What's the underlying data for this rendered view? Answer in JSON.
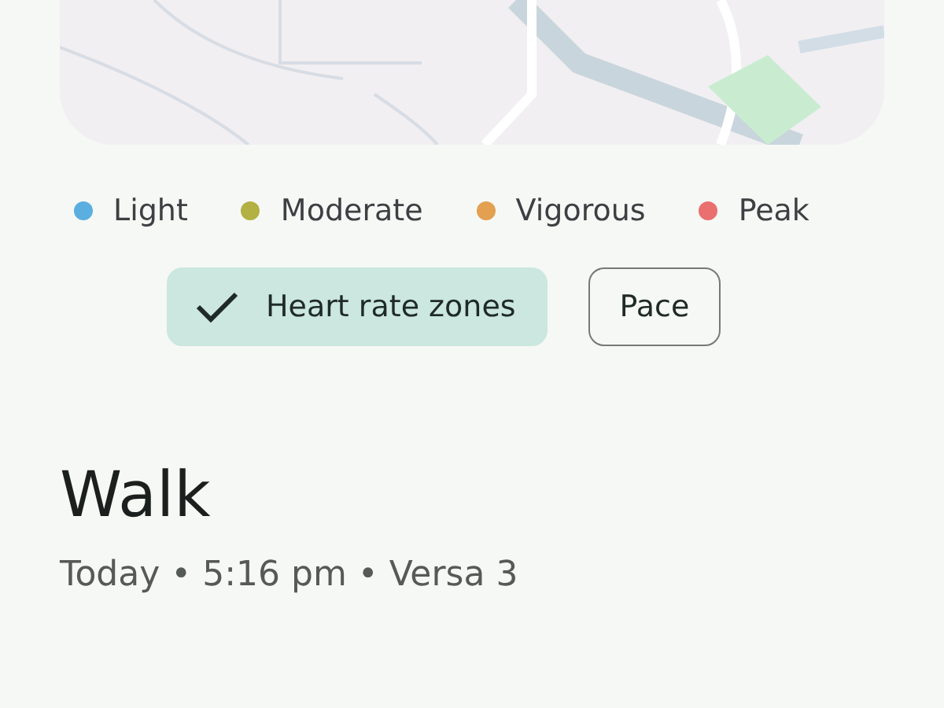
{
  "legend": [
    {
      "label": "Light",
      "color": "#5aaee0"
    },
    {
      "label": "Moderate",
      "color": "#b3b044"
    },
    {
      "label": "Vigorous",
      "color": "#e3a050"
    },
    {
      "label": "Peak",
      "color": "#ea6f6f"
    }
  ],
  "chips": [
    {
      "label": "Heart rate zones",
      "selected": true
    },
    {
      "label": "Pace",
      "selected": false
    }
  ],
  "activity": {
    "title": "Walk",
    "subtitle": "Today • 5:16 pm • Versa 3"
  }
}
